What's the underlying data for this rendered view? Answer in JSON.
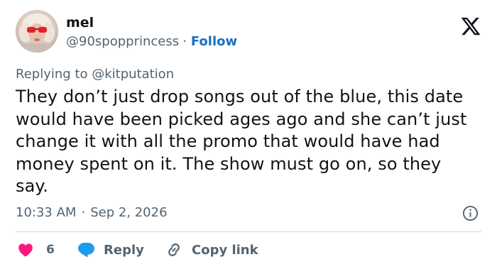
{
  "user": {
    "display_name": "mel",
    "handle": "@90spopprincess",
    "separator": "·",
    "follow_label": "Follow"
  },
  "reply_context": {
    "prefix": "Replying to",
    "mention": "@kitputation"
  },
  "tweet": {
    "text": "They don’t just drop songs out of the blue, this date would have been picked ages ago and she can’t just change it with all the promo that would have had money spent on it. The show must go on, so they say.",
    "time": "10:33 AM",
    "separator": "·",
    "date": "Sep 2, 2026"
  },
  "actions": {
    "like_count": "6",
    "reply_label": "Reply",
    "copy_label": "Copy link"
  },
  "icons": {
    "brand": "x-logo-icon",
    "info": "info-icon",
    "like": "heart-icon",
    "reply": "speech-bubble-icon",
    "copy": "link-icon"
  },
  "colors": {
    "text": "#0f1419",
    "secondary": "#536471",
    "link": "#1d70c1",
    "like": "#f91880",
    "reply_icon": "#1d9bf0",
    "divider": "#cfd9de"
  }
}
